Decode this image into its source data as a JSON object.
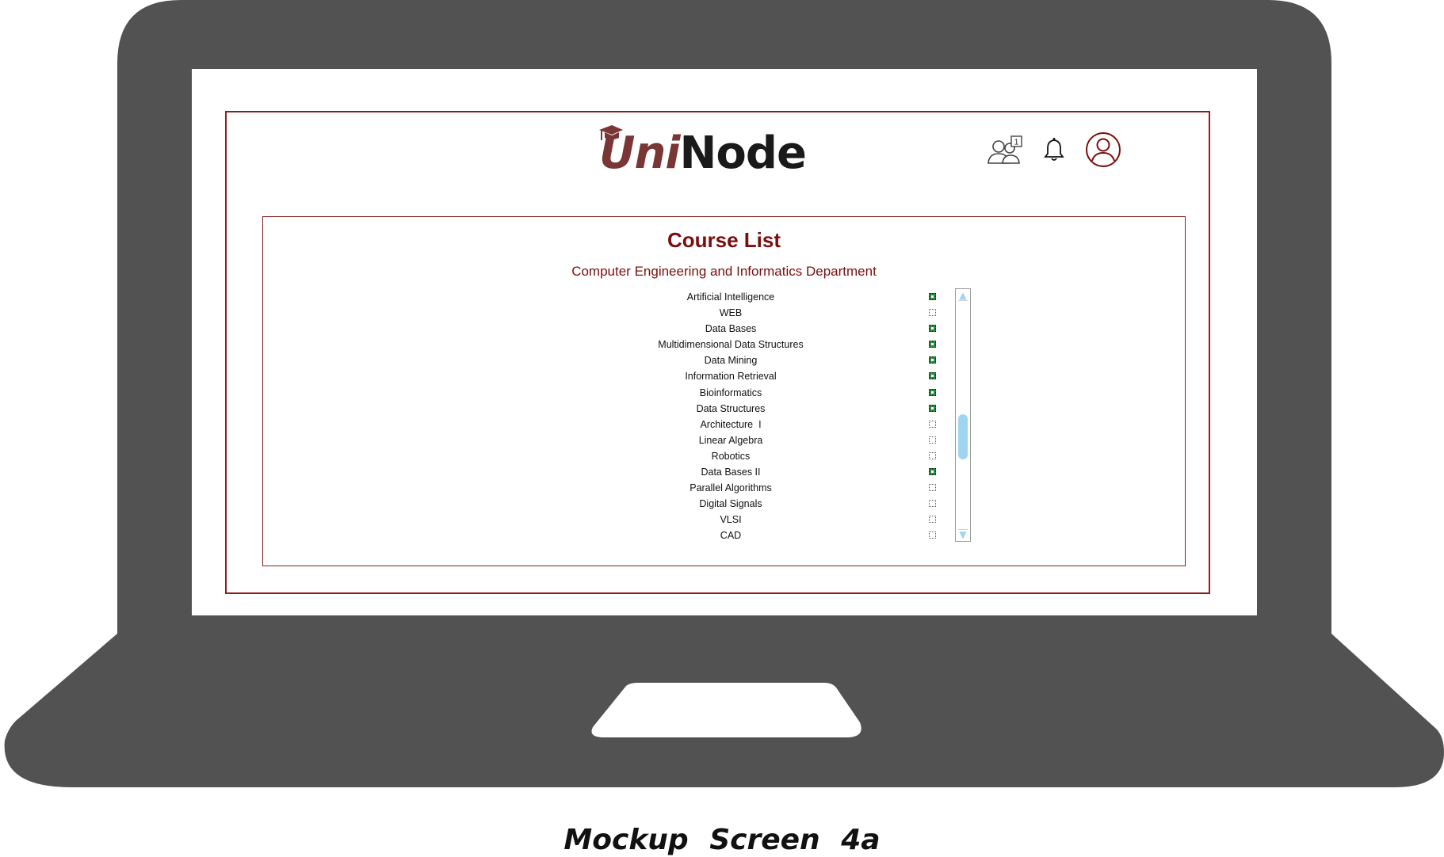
{
  "app": {
    "logo": {
      "part1": "Uni",
      "part2": "Node"
    },
    "header_icons": [
      {
        "icon": "friends-icon",
        "badge": "1"
      },
      {
        "icon": "bell-icon"
      },
      {
        "icon": "user-profile-icon"
      }
    ]
  },
  "page": {
    "title": "Course List",
    "department": "Computer Engineering and Informatics Department"
  },
  "courses": [
    {
      "name": "Artificial Intelligence",
      "checked": true
    },
    {
      "name": "WEB",
      "checked": false
    },
    {
      "name": "Data Bases",
      "checked": true
    },
    {
      "name": "Multidimensional Data Structures",
      "checked": true
    },
    {
      "name": "Data Mining",
      "checked": true
    },
    {
      "name": "Information Retrieval",
      "checked": true
    },
    {
      "name": "Bioinformatics",
      "checked": true
    },
    {
      "name": "Data Structures",
      "checked": true
    },
    {
      "name": "Architecture  I",
      "checked": false
    },
    {
      "name": "Linear Algebra",
      "checked": false
    },
    {
      "name": "Robotics",
      "checked": false
    },
    {
      "name": "Data Bases II",
      "checked": true
    },
    {
      "name": "Parallel Algorithms",
      "checked": false
    },
    {
      "name": "Digital Signals",
      "checked": false
    },
    {
      "name": "VLSI",
      "checked": false
    },
    {
      "name": "CAD",
      "checked": false
    }
  ],
  "scrollbar": {
    "thumb_position": 0.62,
    "thumb_size": 0.2,
    "up_arrow": "▲",
    "down_arrow": "▼"
  },
  "colors": {
    "accent": "#8b1f1f",
    "logo_uni": "#7a3535",
    "laptop_body": "#525252",
    "checked_box": "#2b8a3e",
    "scroll_accent": "#9fd5f2"
  },
  "caption": "Mockup  Screen 4a"
}
